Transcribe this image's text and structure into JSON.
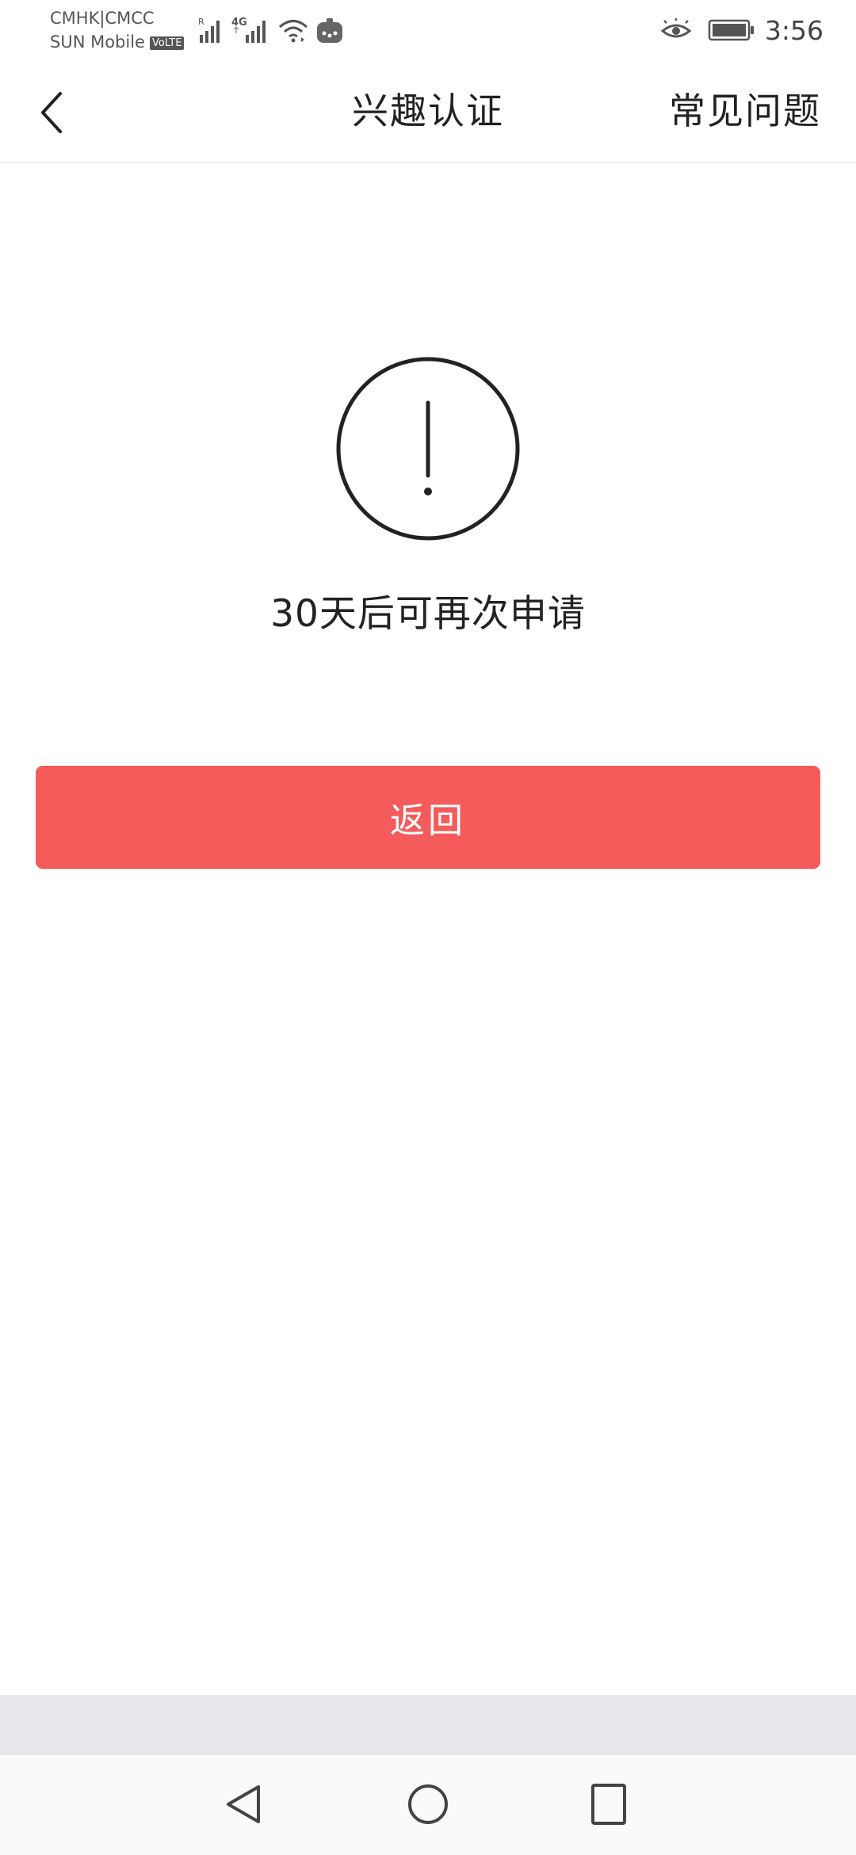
{
  "status_bar": {
    "carrier_line1": "CMHK|CMCC",
    "carrier_line2": "SUN Mobile",
    "volte_badge": "VoLTE",
    "roaming_label": "R",
    "network_type": "4G",
    "time": "3:56",
    "icons": [
      "signal-icon",
      "wifi-icon",
      "notification-app-icon",
      "eye-comfort-icon",
      "battery-icon"
    ]
  },
  "header": {
    "back_icon": "chevron-left-icon",
    "title": "兴趣认证",
    "faq_label": "常见问题"
  },
  "main": {
    "alert_icon": "exclamation-circle-icon",
    "message": "30天后可再次申请",
    "return_button_label": "返回",
    "accent_color": "#f65b5c"
  },
  "nav_bar": {
    "icons": [
      "nav-back-icon",
      "nav-home-icon",
      "nav-recent-icon"
    ]
  }
}
